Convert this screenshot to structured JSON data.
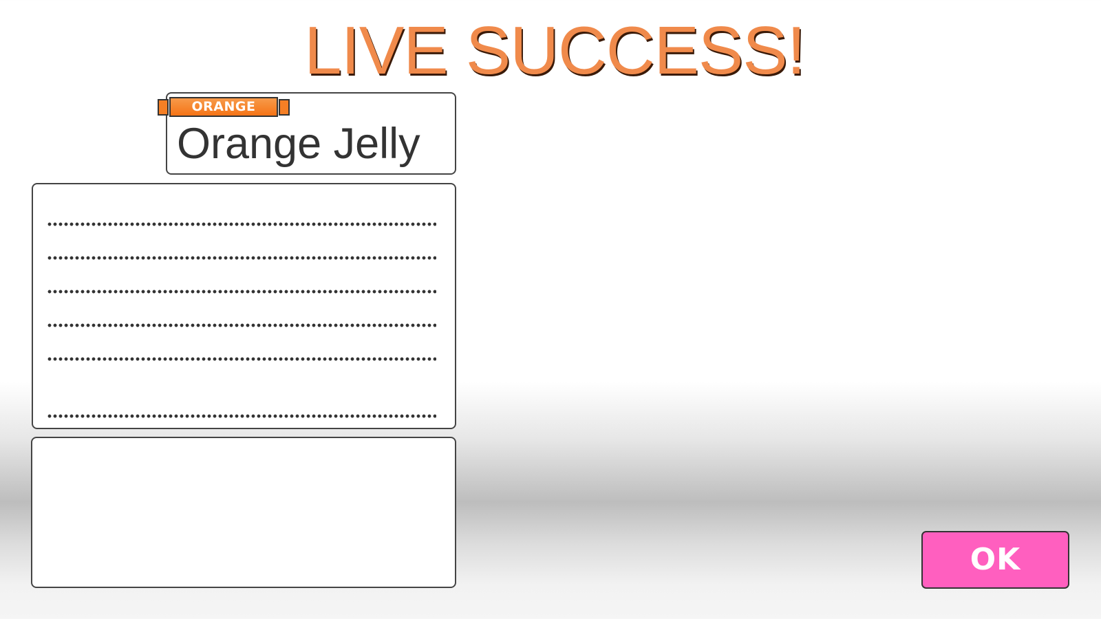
{
  "header": {
    "title": "LIVE SUCCESS!"
  },
  "song": {
    "attribute": "ORANGE",
    "title": "Orange Jelly"
  },
  "result_panel": {
    "rows": [
      "",
      "",
      "",
      "",
      "",
      ""
    ]
  },
  "extra_panel": {
    "content": ""
  },
  "actions": {
    "ok_label": "OK"
  },
  "colors": {
    "title": "#f08a4b",
    "attribute_tag": "#f57f25",
    "ok_button": "#ff5fbf"
  }
}
